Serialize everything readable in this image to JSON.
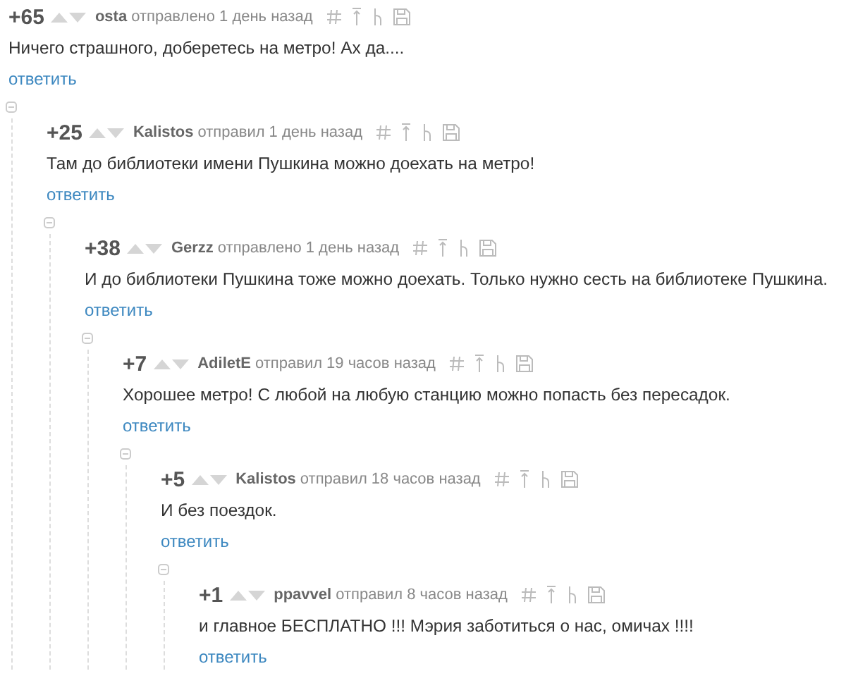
{
  "comments": [
    {
      "score": "+65",
      "author": "osta",
      "action": "отправлено",
      "time": "1 день назад",
      "text": "Ничего страшного, доберетесь на метро! Ах да....",
      "reply": "ответить",
      "collapsed": false,
      "children": [
        {
          "score": "+25",
          "author": "Kalistos",
          "action": "отправил",
          "time": "1 день назад",
          "text": "Там до библиотеки имени Пушкина можно доехать на метро!",
          "reply": "ответить",
          "collapsed": false,
          "children": [
            {
              "score": "+38",
              "author": "Gerzz",
              "action": "отправлено",
              "time": "1 день назад",
              "text": "И до библиотеки Пушкина тоже можно доехать. Только нужно сесть на библиотеке Пушкина.",
              "reply": "ответить",
              "collapsed": false,
              "children": [
                {
                  "score": "+7",
                  "author": "AdiletE",
                  "action": "отправил",
                  "time": "19 часов назад",
                  "text": "Хорошее метро! С любой на любую станцию можно попасть без пересадок.",
                  "reply": "ответить",
                  "collapsed": false,
                  "children": [
                    {
                      "score": "+5",
                      "author": "Kalistos",
                      "action": "отправил",
                      "time": "18 часов назад",
                      "text": "И без поездок.",
                      "reply": "ответить",
                      "collapsed": false,
                      "children": [
                        {
                          "score": "+1",
                          "author": "ppavvel",
                          "action": "отправил",
                          "time": "8 часов назад",
                          "text": "и главное БЕСПЛАТНО !!! Мэрия заботиться о нас, омичах !!!!",
                          "reply": "ответить"
                        }
                      ]
                    }
                  ]
                }
              ]
            }
          ]
        }
      ]
    }
  ]
}
